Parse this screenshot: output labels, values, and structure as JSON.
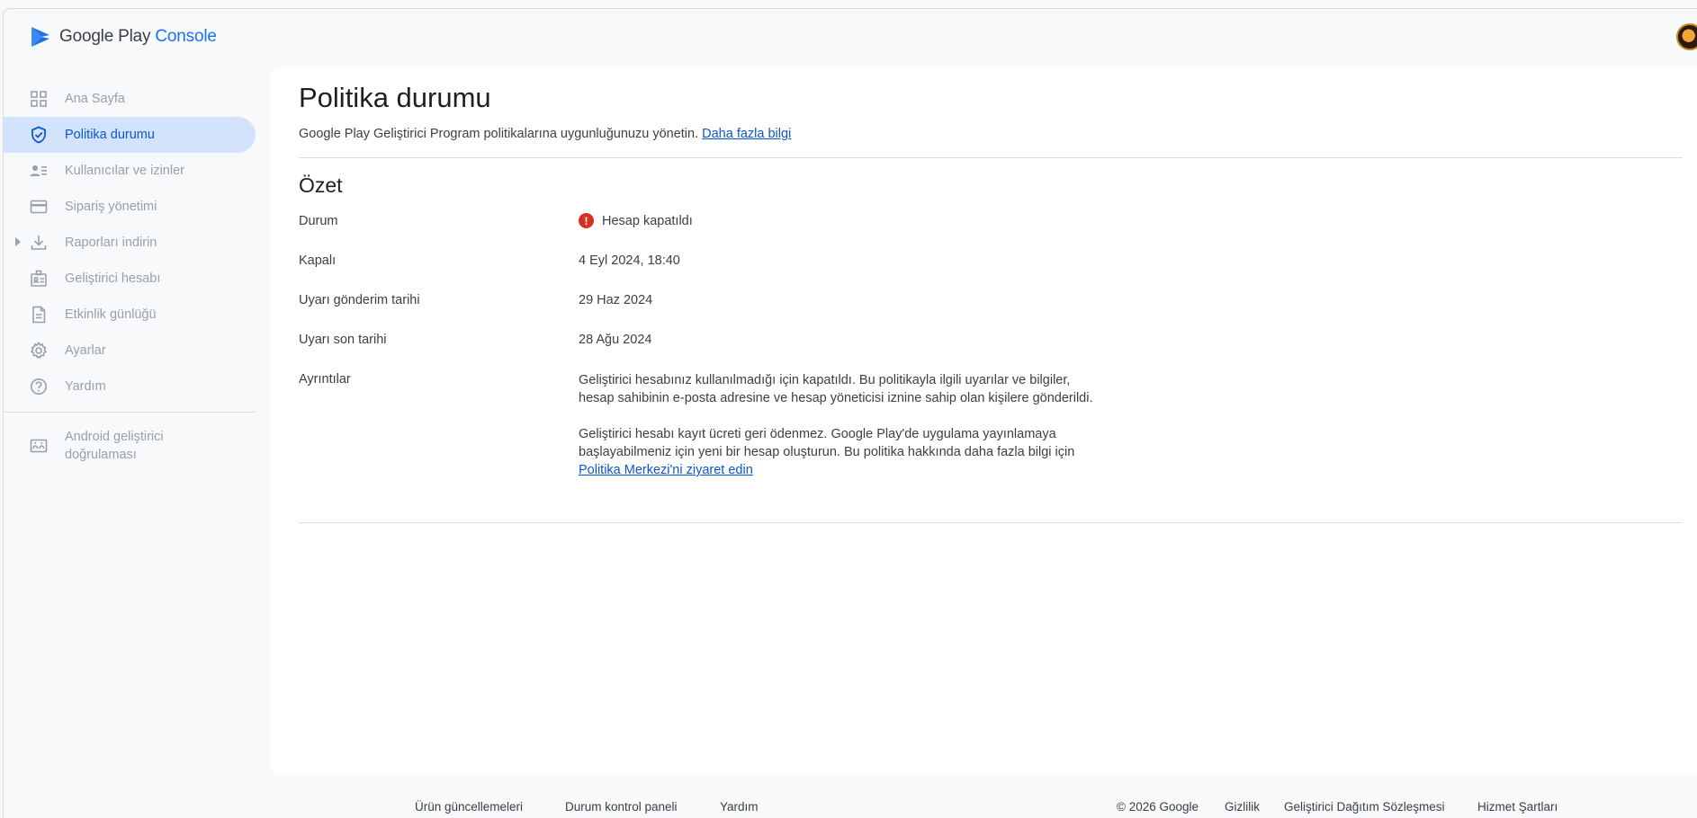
{
  "header": {
    "logo_text": "Google Play",
    "logo_console": "Console",
    "avatar_icon": "user-avatar-icon"
  },
  "sidebar": {
    "items": [
      {
        "label": "Ana Sayfa",
        "icon": "dashboard-grid-icon",
        "active": false
      },
      {
        "label": "Politika durumu",
        "icon": "shield-check-icon",
        "active": true
      },
      {
        "label": "Kullanıcılar ve izinler",
        "icon": "users-list-icon",
        "active": false
      },
      {
        "label": "Sipariş yönetimi",
        "icon": "credit-card-icon",
        "active": false
      },
      {
        "label": "Raporları indirin",
        "icon": "download-icon",
        "active": false
      },
      {
        "label": "Geliştirici hesabı",
        "icon": "developer-account-icon",
        "active": false
      },
      {
        "label": "Etkinlik günlüğü",
        "icon": "document-icon",
        "active": false
      },
      {
        "label": "Ayarlar",
        "icon": "gear-icon",
        "active": false
      },
      {
        "label": "Yardım",
        "icon": "help-icon",
        "active": false
      }
    ],
    "android_verification": {
      "line1": "Android geliştirici",
      "line2": "doğrulaması",
      "icon": "android-verification-icon"
    }
  },
  "main": {
    "title": "Politika durumu",
    "subtitle": "Google Play Geliştirici Program politikalarına uygunluğunuzu yönetin.",
    "subtitle_link": "Daha fazla bilgi",
    "summary": {
      "title": "Özet",
      "rows": [
        {
          "label": "Durum",
          "value": "Hesap kapatıldı",
          "status_color": "#d93025"
        },
        {
          "label": "Kapalı",
          "value": "4 Eyl 2024, 18:40"
        },
        {
          "label": "Uyarı gönderim tarihi",
          "value": "29 Haz 2024"
        },
        {
          "label": "Uyarı son tarihi",
          "value": "28 Ağu 2024"
        }
      ],
      "details_label": "Ayrıntılar",
      "details_p1_line1": "Geliştirici hesabınız kullanılmadığı için kapatıldı. Bu politikayla ilgili uyarılar ve bilgiler,",
      "details_p1_line2": "hesap sahibinin e-posta adresine ve hesap yöneticisi iznine sahip olan kişilere gönderildi.",
      "details_p2_line1": "Geliştirici hesabı kayıt ücreti geri ödenmez. Google Play'de uygulama yayınlamaya",
      "details_p2_line2": "başlayabilmeniz için yeni bir hesap oluşturun. Bu politika hakkında daha fazla bilgi için",
      "details_link": "Politika Merkezi'ni ziyaret edin"
    }
  },
  "footer": {
    "links": [
      "Ürün güncellemeleri",
      "Durum kontrol paneli",
      "Yardım",
      "© 2026 Google",
      "Gizlilik",
      "Geliştirici Dağıtım Sözleşmesi",
      "Hizmet Şartları"
    ]
  }
}
